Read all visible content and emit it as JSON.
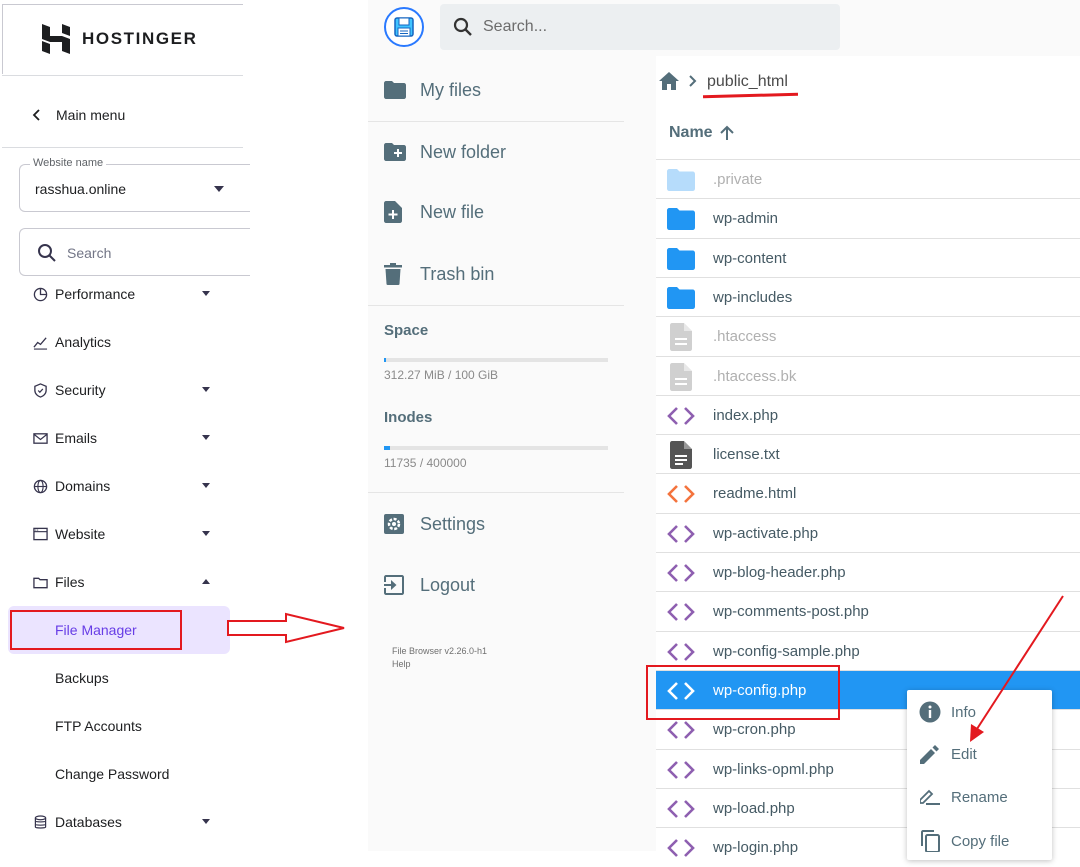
{
  "hostinger": {
    "logo_text": "HOSTINGER",
    "main_menu": "Main menu",
    "website_field": {
      "legend": "Website name",
      "value": "rasshua.online"
    },
    "search_placeholder": "Search",
    "nav": [
      {
        "label": "Performance",
        "icon": "pie-chart-icon",
        "expandable": true
      },
      {
        "label": "Analytics",
        "icon": "trend-line-icon",
        "expandable": false
      },
      {
        "label": "Security",
        "icon": "shield-icon",
        "expandable": true
      },
      {
        "label": "Emails",
        "icon": "envelope-icon",
        "expandable": true
      },
      {
        "label": "Domains",
        "icon": "globe-icon",
        "expandable": true
      },
      {
        "label": "Website",
        "icon": "browser-window-icon",
        "expandable": true
      },
      {
        "label": "Files",
        "icon": "folder-outline-icon",
        "expandable": true,
        "expanded": true
      },
      {
        "label": "Databases",
        "icon": "database-icon",
        "expandable": true
      }
    ],
    "files_submenu": [
      "File Manager",
      "Backups",
      "FTP Accounts",
      "Change Password"
    ],
    "active_item": "File Manager",
    "accent_color": "#673de6"
  },
  "filebrowser": {
    "search_placeholder": "Search...",
    "menu": {
      "my_files": "My files",
      "new_folder": "New folder",
      "new_file": "New file",
      "trash_bin": "Trash bin",
      "settings": "Settings",
      "logout": "Logout"
    },
    "space": {
      "label": "Space",
      "text": "312.27 MiB / 100 GiB",
      "fraction": 0.003
    },
    "inodes": {
      "label": "Inodes",
      "text": "11735 / 400000",
      "fraction": 0.029
    },
    "version_line1": "File Browser v2.26.0-h1",
    "version_line2": "Help",
    "breadcrumb": "public_html",
    "column_name": "Name",
    "files": [
      {
        "name": ".private",
        "type": "folder",
        "hidden": true
      },
      {
        "name": "wp-admin",
        "type": "folder"
      },
      {
        "name": "wp-content",
        "type": "folder"
      },
      {
        "name": "wp-includes",
        "type": "folder"
      },
      {
        "name": ".htaccess",
        "type": "file",
        "hidden": true
      },
      {
        "name": ".htaccess.bk",
        "type": "file",
        "hidden": true
      },
      {
        "name": "index.php",
        "type": "code"
      },
      {
        "name": "license.txt",
        "type": "text"
      },
      {
        "name": "readme.html",
        "type": "html"
      },
      {
        "name": "wp-activate.php",
        "type": "code"
      },
      {
        "name": "wp-blog-header.php",
        "type": "code"
      },
      {
        "name": "wp-comments-post.php",
        "type": "code"
      },
      {
        "name": "wp-config-sample.php",
        "type": "code"
      },
      {
        "name": "wp-config.php",
        "type": "code",
        "selected": true
      },
      {
        "name": "wp-cron.php",
        "type": "code"
      },
      {
        "name": "wp-links-opml.php",
        "type": "code"
      },
      {
        "name": "wp-load.php",
        "type": "code"
      },
      {
        "name": "wp-login.php",
        "type": "code"
      }
    ],
    "context_menu": [
      "Info",
      "Edit",
      "Rename",
      "Copy file"
    ],
    "accent_color": "#2196f3",
    "annotation_color": "#e3191f"
  }
}
